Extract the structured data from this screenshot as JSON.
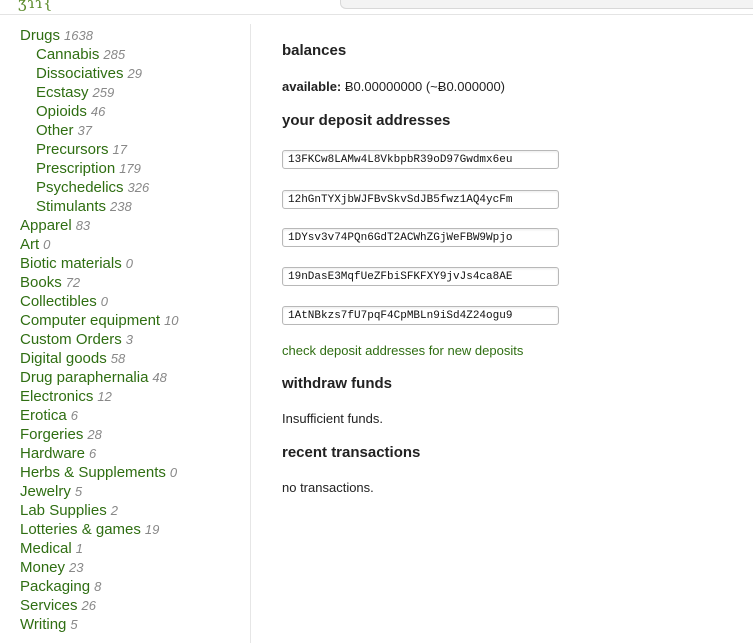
{
  "header": {
    "logo_text": "ʒɿɿ{"
  },
  "sidebar": {
    "categories": [
      {
        "label": "Drugs",
        "count": "1638",
        "sub": false
      },
      {
        "label": "Cannabis",
        "count": "285",
        "sub": true
      },
      {
        "label": "Dissociatives",
        "count": "29",
        "sub": true
      },
      {
        "label": "Ecstasy",
        "count": "259",
        "sub": true
      },
      {
        "label": "Opioids",
        "count": "46",
        "sub": true
      },
      {
        "label": "Other",
        "count": "37",
        "sub": true
      },
      {
        "label": "Precursors",
        "count": "17",
        "sub": true
      },
      {
        "label": "Prescription",
        "count": "179",
        "sub": true
      },
      {
        "label": "Psychedelics",
        "count": "326",
        "sub": true
      },
      {
        "label": "Stimulants",
        "count": "238",
        "sub": true
      },
      {
        "label": "Apparel",
        "count": "83",
        "sub": false
      },
      {
        "label": "Art",
        "count": "0",
        "sub": false
      },
      {
        "label": "Biotic materials",
        "count": "0",
        "sub": false
      },
      {
        "label": "Books",
        "count": "72",
        "sub": false
      },
      {
        "label": "Collectibles",
        "count": "0",
        "sub": false
      },
      {
        "label": "Computer equipment",
        "count": "10",
        "sub": false
      },
      {
        "label": "Custom Orders",
        "count": "3",
        "sub": false
      },
      {
        "label": "Digital goods",
        "count": "58",
        "sub": false
      },
      {
        "label": "Drug paraphernalia",
        "count": "48",
        "sub": false
      },
      {
        "label": "Electronics",
        "count": "12",
        "sub": false
      },
      {
        "label": "Erotica",
        "count": "6",
        "sub": false
      },
      {
        "label": "Forgeries",
        "count": "28",
        "sub": false
      },
      {
        "label": "Hardware",
        "count": "6",
        "sub": false
      },
      {
        "label": "Herbs & Supplements",
        "count": "0",
        "sub": false
      },
      {
        "label": "Jewelry",
        "count": "5",
        "sub": false
      },
      {
        "label": "Lab Supplies",
        "count": "2",
        "sub": false
      },
      {
        "label": "Lotteries & games",
        "count": "19",
        "sub": false
      },
      {
        "label": "Medical",
        "count": "1",
        "sub": false
      },
      {
        "label": "Money",
        "count": "23",
        "sub": false
      },
      {
        "label": "Packaging",
        "count": "8",
        "sub": false
      },
      {
        "label": "Services",
        "count": "26",
        "sub": false
      },
      {
        "label": "Writing",
        "count": "5",
        "sub": false
      }
    ]
  },
  "main": {
    "balances_heading": "balances",
    "available_label": "available:",
    "available_value": "Ƀ0.00000000 (~Ƀ0.000000)",
    "deposit_heading": "your deposit addresses",
    "addresses": [
      "13FKCw8LAMw4L8VkbpbR39oD97Gwdmx6eu",
      "12hGnTYXjbWJFBvSkvSdJB5fwz1AQ4ycFm",
      "1DYsv3v74PQn6GdT2ACWhZGjWeFBW9Wpjo",
      "19nDasE3MqfUeZFbiSFKFXY9jvJs4ca8AE",
      "1AtNBkzs7fU7pqF4CpMBLn9iSd4Z24ogu9"
    ],
    "check_link": "check deposit addresses for new deposits",
    "withdraw_heading": "withdraw funds",
    "withdraw_text": "Insufficient funds.",
    "transactions_heading": "recent transactions",
    "transactions_text": "no transactions."
  }
}
